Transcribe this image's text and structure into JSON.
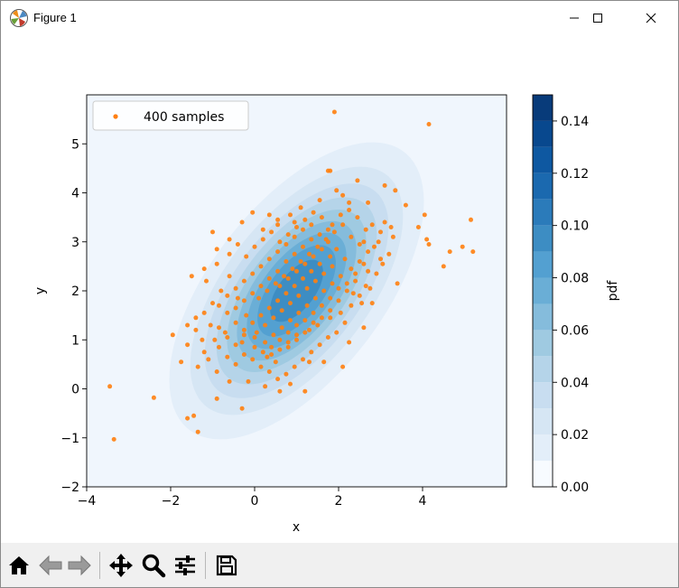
{
  "window": {
    "title": "Figure 1",
    "icon": "matplotlib-figure-icon",
    "controls": [
      "minimize-icon",
      "maximize-icon",
      "close-icon"
    ]
  },
  "toolbar": {
    "buttons": [
      {
        "name": "home-button",
        "icon": "home-icon"
      },
      {
        "name": "back-button",
        "icon": "back-arrow-icon"
      },
      {
        "name": "forward-button",
        "icon": "forward-arrow-icon"
      },
      {
        "name": "pan-button",
        "icon": "move-icon"
      },
      {
        "name": "zoom-button",
        "icon": "magnifier-icon"
      },
      {
        "name": "subplots-button",
        "icon": "sliders-icon"
      },
      {
        "name": "save-button",
        "icon": "floppy-disk-icon"
      }
    ]
  },
  "chart_data": {
    "type": "scatter",
    "xlabel": "x",
    "ylabel": "y",
    "xlim": [
      -4,
      6
    ],
    "ylim": [
      -2,
      6
    ],
    "xticks": [
      "−4",
      "−2",
      "0",
      "2",
      "4"
    ],
    "yticks": [
      "−2",
      "−1",
      "0",
      "1",
      "2",
      "3",
      "4",
      "5"
    ],
    "legend": {
      "label": "400 samples",
      "position": "top-left"
    },
    "marker_color": "#ff7f0e",
    "background_color": "#f0f6fd",
    "contour": {
      "center": [
        1,
        2
      ],
      "levels": [
        0.01,
        0.02,
        0.03,
        0.04,
        0.05,
        0.06,
        0.07,
        0.08,
        0.09,
        0.1,
        0.11,
        0.12,
        0.13,
        0.14
      ],
      "colors": [
        "#e3eef9",
        "#d6e6f4",
        "#c8ddf0",
        "#b5d4e9",
        "#9fcae1",
        "#85bcdc",
        "#6aaed6",
        "#53a0d1",
        "#3d8dc3",
        "#2b7bba",
        "#1b69af",
        "#0e58a1",
        "#08488e",
        "#083b7a"
      ]
    },
    "colorbar": {
      "label": "pdf",
      "range": [
        0,
        0.15
      ],
      "ticks": [
        "0.00",
        "0.02",
        "0.04",
        "0.06",
        "0.08",
        "0.10",
        "0.12",
        "0.14"
      ]
    },
    "points": [
      [
        -3.45,
        0.05
      ],
      [
        -3.35,
        -1.03
      ],
      [
        -2.4,
        -0.18
      ],
      [
        -1.6,
        -0.6
      ],
      [
        -1.45,
        -0.55
      ],
      [
        -1.35,
        -0.88
      ],
      [
        -1.75,
        0.55
      ],
      [
        -1.95,
        1.1
      ],
      [
        -1.6,
        1.3
      ],
      [
        -1.4,
        1.45
      ],
      [
        -1.5,
        2.3
      ],
      [
        -1.15,
        2.2
      ],
      [
        -1.2,
        2.45
      ],
      [
        -0.9,
        2.55
      ],
      [
        -1.0,
        3.2
      ],
      [
        -0.6,
        2.75
      ],
      [
        -0.4,
        2.95
      ],
      [
        -0.3,
        3.4
      ],
      [
        -0.05,
        3.6
      ],
      [
        0.2,
        3.25
      ],
      [
        0.35,
        3.55
      ],
      [
        0.55,
        3.35
      ],
      [
        0.85,
        3.55
      ],
      [
        1.1,
        3.7
      ],
      [
        1.55,
        3.85
      ],
      [
        1.75,
        4.45
      ],
      [
        1.8,
        4.45
      ],
      [
        1.95,
        4.05
      ],
      [
        2.1,
        3.95
      ],
      [
        2.25,
        3.8
      ],
      [
        2.45,
        4.25
      ],
      [
        2.7,
        3.8
      ],
      [
        2.8,
        3.35
      ],
      [
        3.1,
        3.4
      ],
      [
        3.3,
        3.1
      ],
      [
        3.1,
        4.15
      ],
      [
        3.35,
        4.05
      ],
      [
        3.6,
        3.75
      ],
      [
        4.05,
        3.55
      ],
      [
        3.9,
        3.3
      ],
      [
        4.1,
        3.05
      ],
      [
        4.15,
        5.4
      ],
      [
        4.5,
        2.5
      ],
      [
        4.65,
        2.8
      ],
      [
        4.95,
        2.9
      ],
      [
        5.15,
        3.45
      ],
      [
        5.2,
        2.8
      ],
      [
        4.15,
        2.95
      ],
      [
        1.9,
        5.65
      ],
      [
        3.4,
        2.15
      ],
      [
        2.65,
        2.1
      ],
      [
        2.6,
        1.25
      ],
      [
        2.25,
        0.95
      ],
      [
        2.1,
        0.45
      ],
      [
        1.65,
        0.55
      ],
      [
        1.2,
        -0.05
      ],
      [
        0.6,
        -0.05
      ],
      [
        0.25,
        0.05
      ],
      [
        -0.3,
        -0.4
      ],
      [
        -0.9,
        -0.2
      ],
      [
        -0.6,
        0.15
      ],
      [
        -0.9,
        0.35
      ],
      [
        -1.1,
        0.6
      ],
      [
        -1.2,
        0.75
      ],
      [
        -0.95,
        1.0
      ],
      [
        -0.7,
        1.15
      ],
      [
        -0.45,
        1.35
      ],
      [
        -0.3,
        0.95
      ],
      [
        0.0,
        0.85
      ],
      [
        0.3,
        0.65
      ],
      [
        0.5,
        0.55
      ],
      [
        0.8,
        0.85
      ],
      [
        1.0,
        1.1
      ],
      [
        1.3,
        1.2
      ],
      [
        1.5,
        1.3
      ],
      [
        1.8,
        1.45
      ],
      [
        2.05,
        1.55
      ],
      [
        2.3,
        1.7
      ],
      [
        2.5,
        1.9
      ],
      [
        2.75,
        2.05
      ],
      [
        2.9,
        2.35
      ],
      [
        3.05,
        2.55
      ],
      [
        3.2,
        2.75
      ],
      [
        2.95,
        3.0
      ],
      [
        2.7,
        2.8
      ],
      [
        2.5,
        2.6
      ],
      [
        2.3,
        2.45
      ],
      [
        2.15,
        2.65
      ],
      [
        1.95,
        2.85
      ],
      [
        1.75,
        3.0
      ],
      [
        1.55,
        3.15
      ],
      [
        1.35,
        3.05
      ],
      [
        1.15,
        2.9
      ],
      [
        0.95,
        2.75
      ],
      [
        0.75,
        2.6
      ],
      [
        0.55,
        2.4
      ],
      [
        0.35,
        2.25
      ],
      [
        0.15,
        2.1
      ],
      [
        -0.05,
        1.95
      ],
      [
        -0.25,
        1.8
      ],
      [
        -0.45,
        1.65
      ],
      [
        -0.65,
        1.55
      ],
      [
        -0.85,
        1.7
      ],
      [
        -0.65,
        1.9
      ],
      [
        -0.45,
        2.05
      ],
      [
        -0.25,
        2.2
      ],
      [
        -0.05,
        2.35
      ],
      [
        0.15,
        2.5
      ],
      [
        0.35,
        2.65
      ],
      [
        0.55,
        2.8
      ],
      [
        0.75,
        2.95
      ],
      [
        0.95,
        3.1
      ],
      [
        1.15,
        3.25
      ],
      [
        1.35,
        3.35
      ],
      [
        1.55,
        2.55
      ],
      [
        1.35,
        2.4
      ],
      [
        1.15,
        2.25
      ],
      [
        0.95,
        2.1
      ],
      [
        0.75,
        1.95
      ],
      [
        0.55,
        1.8
      ],
      [
        0.35,
        1.65
      ],
      [
        0.15,
        1.5
      ],
      [
        -0.05,
        1.35
      ],
      [
        -0.25,
        1.2
      ],
      [
        0.05,
        1.15
      ],
      [
        0.25,
        1.3
      ],
      [
        0.45,
        1.45
      ],
      [
        0.65,
        1.6
      ],
      [
        0.85,
        1.75
      ],
      [
        1.05,
        1.9
      ],
      [
        1.25,
        2.05
      ],
      [
        1.45,
        2.2
      ],
      [
        1.65,
        2.35
      ],
      [
        1.85,
        2.5
      ],
      [
        2.05,
        2.3
      ],
      [
        1.85,
        2.15
      ],
      [
        1.65,
        2.0
      ],
      [
        1.45,
        1.85
      ],
      [
        1.25,
        1.7
      ],
      [
        1.05,
        1.55
      ],
      [
        0.85,
        1.4
      ],
      [
        0.65,
        1.25
      ],
      [
        0.45,
        1.1
      ],
      [
        0.25,
        0.95
      ],
      [
        0.6,
        2.1
      ],
      [
        0.8,
        2.25
      ],
      [
        1.0,
        2.4
      ],
      [
        1.2,
        2.55
      ],
      [
        1.4,
        2.7
      ],
      [
        1.6,
        2.85
      ],
      [
        1.8,
        2.7
      ],
      [
        2.0,
        2.05
      ],
      [
        1.8,
        1.85
      ],
      [
        1.6,
        1.7
      ],
      [
        1.4,
        1.55
      ],
      [
        1.2,
        1.4
      ],
      [
        1.0,
        1.3
      ],
      [
        0.8,
        1.15
      ],
      [
        0.6,
        1.0
      ],
      [
        0.4,
        0.85
      ],
      [
        0.1,
        1.85
      ],
      [
        0.3,
        2.0
      ],
      [
        0.5,
        2.15
      ],
      [
        0.7,
        2.3
      ],
      [
        0.9,
        2.45
      ],
      [
        1.1,
        2.6
      ],
      [
        1.3,
        2.75
      ],
      [
        1.5,
        2.9
      ],
      [
        1.7,
        3.05
      ],
      [
        1.9,
        3.2
      ],
      [
        2.1,
        3.35
      ],
      [
        2.3,
        3.1
      ],
      [
        2.5,
        2.95
      ],
      [
        2.7,
        2.4
      ],
      [
        2.4,
        2.2
      ],
      [
        2.2,
        2.0
      ],
      [
        2.0,
        1.8
      ],
      [
        1.8,
        1.6
      ],
      [
        1.6,
        1.45
      ],
      [
        1.4,
        1.35
      ],
      [
        1.2,
        1.15
      ],
      [
        1.0,
        1.0
      ],
      [
        0.8,
        0.95
      ],
      [
        0.6,
        0.8
      ],
      [
        0.4,
        0.7
      ],
      [
        0.2,
        0.75
      ],
      [
        0.0,
        1.05
      ],
      [
        -0.2,
        1.5
      ],
      [
        -0.4,
        1.85
      ],
      [
        -0.6,
        2.3
      ],
      [
        -0.8,
        2.0
      ],
      [
        -1.0,
        1.75
      ],
      [
        -1.2,
        1.55
      ],
      [
        -1.4,
        1.2
      ],
      [
        -1.6,
        0.9
      ],
      [
        -0.2,
        2.7
      ],
      [
        0.0,
        2.9
      ],
      [
        0.2,
        3.05
      ],
      [
        0.4,
        3.2
      ],
      [
        0.6,
        3.0
      ],
      [
        0.8,
        3.15
      ],
      [
        1.0,
        3.3
      ],
      [
        1.2,
        3.45
      ],
      [
        1.4,
        3.6
      ],
      [
        1.6,
        3.5
      ],
      [
        1.85,
        3.35
      ],
      [
        2.05,
        3.55
      ],
      [
        2.25,
        3.65
      ],
      [
        2.45,
        3.5
      ],
      [
        2.65,
        3.25
      ],
      [
        2.85,
        2.9
      ],
      [
        3.0,
        2.65
      ],
      [
        2.6,
        2.55
      ],
      [
        2.4,
        2.35
      ],
      [
        2.2,
        2.15
      ],
      [
        2.35,
        1.95
      ],
      [
        2.55,
        1.75
      ],
      [
        2.15,
        1.35
      ],
      [
        1.95,
        1.15
      ],
      [
        1.75,
        1.05
      ],
      [
        1.55,
        0.9
      ],
      [
        1.35,
        0.75
      ],
      [
        1.15,
        0.6
      ],
      [
        0.95,
        0.45
      ],
      [
        0.75,
        0.3
      ],
      [
        0.55,
        0.2
      ],
      [
        0.35,
        0.35
      ],
      [
        0.15,
        0.45
      ],
      [
        -0.05,
        0.6
      ],
      [
        -0.25,
        0.7
      ],
      [
        -0.45,
        0.5
      ],
      [
        -0.65,
        0.65
      ],
      [
        -0.85,
        0.85
      ],
      [
        -1.05,
        1.3
      ],
      [
        -0.85,
        1.25
      ],
      [
        -0.65,
        1.05
      ],
      [
        -0.45,
        0.9
      ],
      [
        -0.25,
        1.1
      ],
      [
        0.55,
        3.45
      ],
      [
        0.95,
        3.4
      ],
      [
        1.75,
        3.25
      ],
      [
        2.6,
        3.0
      ],
      [
        3.0,
        3.2
      ],
      [
        3.25,
        3.3
      ],
      [
        2.8,
        1.75
      ],
      [
        1.3,
        0.55
      ],
      [
        0.85,
        0.1
      ],
      [
        -0.15,
        0.15
      ],
      [
        -1.35,
        0.45
      ],
      [
        -1.25,
        1.0
      ],
      [
        -0.9,
        2.85
      ],
      [
        -0.6,
        3.05
      ]
    ]
  }
}
